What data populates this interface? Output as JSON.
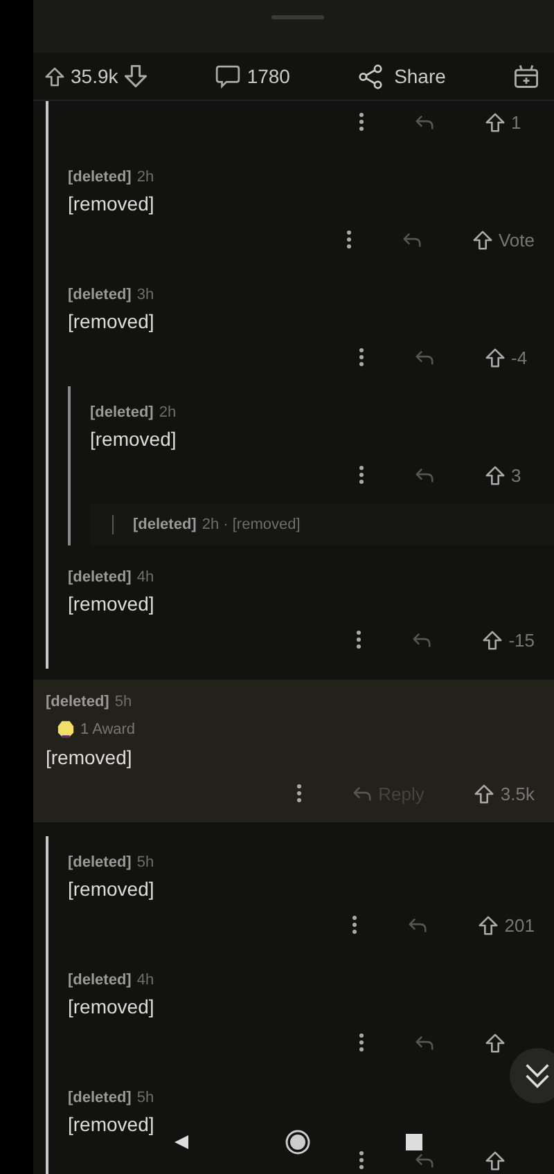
{
  "action_bar": {
    "score": "35.9k",
    "comments": "1780",
    "share": "Share"
  },
  "comments": [
    {
      "kind": "branch",
      "children": [
        {
          "kind": "actions",
          "score": "1"
        },
        {
          "kind": "comment",
          "author": "[deleted]",
          "time": "2h",
          "body": "[removed]",
          "score": "Vote"
        },
        {
          "kind": "comment",
          "author": "[deleted]",
          "time": "3h",
          "body": "[removed]",
          "score": "-4",
          "children": [
            {
              "kind": "comment",
              "author": "[deleted]",
              "time": "2h",
              "body": "[removed]",
              "score": "3",
              "children": [
                {
                  "kind": "collapsed",
                  "author": "[deleted]",
                  "time": "2h · [removed]"
                }
              ]
            }
          ]
        },
        {
          "kind": "comment",
          "author": "[deleted]",
          "time": "4h",
          "body": "[removed]",
          "score": "-15"
        }
      ]
    },
    {
      "kind": "comment",
      "author": "[deleted]",
      "time": "5h",
      "award": "1 Award",
      "body": "[removed]",
      "reply": "Reply",
      "score": "3.5k",
      "highlighted": true
    },
    {
      "kind": "branch",
      "children": [
        {
          "kind": "comment",
          "author": "[deleted]",
          "time": "5h",
          "body": "[removed]",
          "score": "201"
        },
        {
          "kind": "comment",
          "author": "[deleted]",
          "time": "4h",
          "body": "[removed]"
        },
        {
          "kind": "comment",
          "author": "[deleted]",
          "time": "5h",
          "body": "[removed]"
        }
      ]
    }
  ]
}
